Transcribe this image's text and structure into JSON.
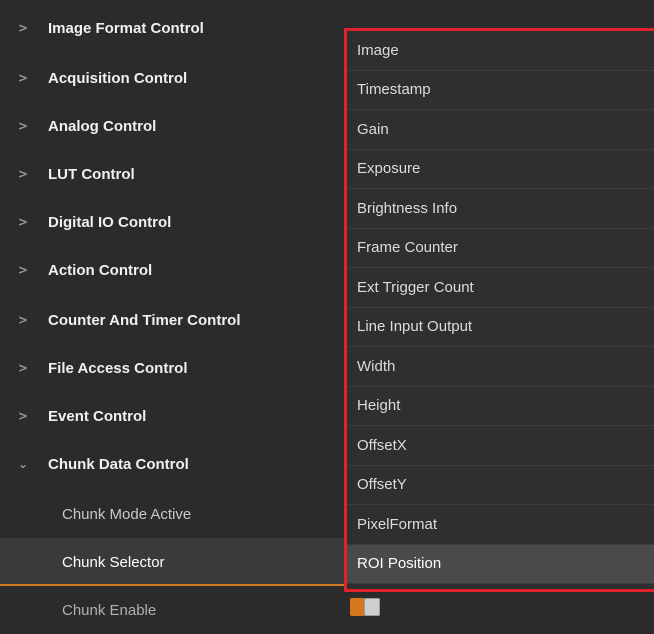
{
  "categories": [
    {
      "label": "Image Format Control"
    },
    {
      "label": "Acquisition Control"
    },
    {
      "label": "Analog Control"
    },
    {
      "label": "LUT Control"
    },
    {
      "label": "Digital IO Control"
    },
    {
      "label": "Action Control"
    },
    {
      "label": "Counter And Timer Control"
    },
    {
      "label": "File Access Control"
    },
    {
      "label": "Event Control"
    },
    {
      "label": "Chunk Data Control"
    }
  ],
  "chunk_items": [
    {
      "label": "Chunk Mode Active"
    },
    {
      "label": "Chunk Selector"
    },
    {
      "label": "Chunk Enable"
    }
  ],
  "dropdown": {
    "options": [
      "Image",
      "Timestamp",
      "Gain",
      "Exposure",
      "Brightness Info",
      "Frame Counter",
      "Ext Trigger Count",
      "Line Input Output",
      "Width",
      "Height",
      "OffsetX",
      "OffsetY",
      "PixelFormat",
      "ROI Position"
    ],
    "selected": "ROI Position"
  },
  "chunk_enable": {
    "on": true
  },
  "colors": {
    "background": "#2b2b2b",
    "accent": "#d8781e",
    "highlight_border": "#e0232b"
  },
  "icons": {
    "collapsed": "chevron-right-icon",
    "expanded": "chevron-down-icon"
  }
}
